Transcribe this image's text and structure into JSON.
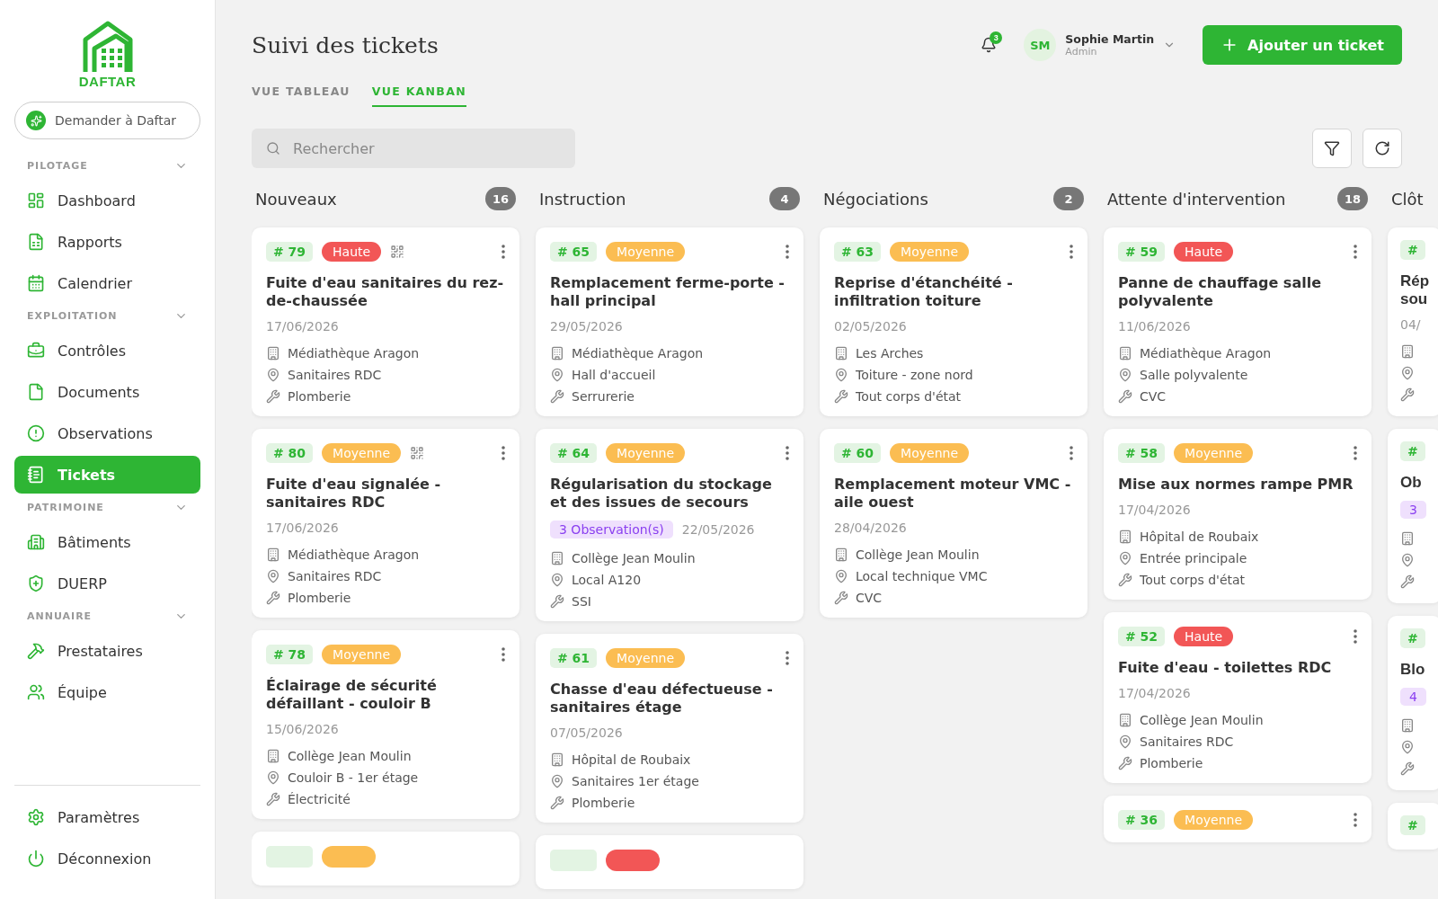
{
  "sidebar": {
    "logo": "DAFTAR",
    "ask_button": "Demander à Daftar",
    "sections": [
      {
        "title": "PILOTAGE",
        "expanded": true,
        "items": [
          {
            "label": "Dashboard",
            "selected": false
          },
          {
            "label": "Rapports",
            "selected": false
          },
          {
            "label": "Calendrier",
            "selected": false
          }
        ]
      },
      {
        "title": "EXPLOITATION",
        "expanded": true,
        "items": [
          {
            "label": "Contrôles",
            "selected": false
          },
          {
            "label": "Documents",
            "selected": false
          },
          {
            "label": "Observations",
            "selected": false
          },
          {
            "label": "Tickets",
            "selected": true
          }
        ]
      },
      {
        "title": "PATRIMOINE",
        "expanded": true,
        "items": [
          {
            "label": "Bâtiments",
            "selected": false
          },
          {
            "label": "DUERP",
            "selected": false
          }
        ]
      },
      {
        "title": "ANNUAIRE",
        "expanded": true,
        "items": [
          {
            "label": "Prestataires",
            "selected": false
          },
          {
            "label": "Équipe",
            "selected": false
          }
        ]
      }
    ],
    "footer": [
      "Paramètres",
      "Déconnexion"
    ]
  },
  "header": {
    "title": "Suivi des tickets",
    "notifications": "3",
    "user": {
      "initials": "SM",
      "name": "Sophie Martin",
      "role": "Admin"
    },
    "add_button": "Ajouter un ticket"
  },
  "tabs": [
    {
      "label": "VUE TABLEAU",
      "selected": false
    },
    {
      "label": "VUE KANBAN",
      "selected": true
    }
  ],
  "search": {
    "placeholder": "Rechercher"
  },
  "columns": [
    {
      "title": "Nouveaux",
      "count": "16",
      "cards": [
        {
          "kind": "ticket",
          "number": "# 79",
          "priority": {
            "label": "Haute",
            "kind": "high"
          },
          "qr": true,
          "title": "Fuite d'eau sanitaires du rez-de-chaussée",
          "date": "17/06/2026",
          "building": "Médiathèque Aragon",
          "place": "Sanitaires RDC",
          "trade": "Plomberie"
        },
        {
          "kind": "ticket",
          "number": "# 80",
          "priority": {
            "label": "Moyenne",
            "kind": "medium"
          },
          "qr": true,
          "title": "Fuite d'eau signalée - sanitaires RDC",
          "date": "17/06/2026",
          "building": "Médiathèque Aragon",
          "place": "Sanitaires RDC",
          "trade": "Plomberie"
        },
        {
          "kind": "ticket",
          "number": "# 78",
          "priority": {
            "label": "Moyenne",
            "kind": "medium"
          },
          "title": "Éclairage de sécurité défaillant - couloir B",
          "date": "15/06/2026",
          "building": "Collège Jean Moulin",
          "place": "Couloir B - 1er étage",
          "trade": "Électricité"
        },
        {
          "kind": "stub",
          "priority": {
            "kind": "medium"
          }
        }
      ]
    },
    {
      "title": "Instruction",
      "count": "4",
      "cards": [
        {
          "kind": "ticket",
          "number": "# 65",
          "priority": {
            "label": "Moyenne",
            "kind": "medium"
          },
          "title": "Remplacement ferme-porte - hall principal",
          "date": "29/05/2026",
          "building": "Médiathèque Aragon",
          "place": "Hall d'accueil",
          "trade": "Serrurerie"
        },
        {
          "kind": "ticket",
          "number": "# 64",
          "priority": {
            "label": "Moyenne",
            "kind": "medium"
          },
          "title": "Régularisation du stockage et des issues de secours",
          "observations": "3 Observation(s)",
          "date": "22/05/2026",
          "building": "Collège Jean Moulin",
          "place": "Local A120",
          "trade": "SSI"
        },
        {
          "kind": "ticket",
          "number": "# 61",
          "priority": {
            "label": "Moyenne",
            "kind": "medium"
          },
          "title": "Chasse d'eau défectueuse - sanitaires étage",
          "date": "07/05/2026",
          "building": "Hôpital de Roubaix",
          "place": "Sanitaires 1er étage",
          "trade": "Plomberie"
        },
        {
          "kind": "stub",
          "priority": {
            "kind": "high"
          }
        }
      ]
    },
    {
      "title": "Négociations",
      "count": "2",
      "cards": [
        {
          "kind": "ticket",
          "number": "# 63",
          "priority": {
            "label": "Moyenne",
            "kind": "medium"
          },
          "title": "Reprise d'étanchéité - infiltration toiture",
          "date": "02/05/2026",
          "building": "Les Arches",
          "place": "Toiture - zone nord",
          "trade": "Tout corps d'état"
        },
        {
          "kind": "ticket",
          "number": "# 60",
          "priority": {
            "label": "Moyenne",
            "kind": "medium"
          },
          "title": "Remplacement moteur VMC - aile ouest",
          "date": "28/04/2026",
          "building": "Collège Jean Moulin",
          "place": "Local technique VMC",
          "trade": "CVC"
        }
      ]
    },
    {
      "title": "Attente d'intervention",
      "count": "18",
      "cards": [
        {
          "kind": "ticket",
          "number": "# 59",
          "priority": {
            "label": "Haute",
            "kind": "high"
          },
          "title": "Panne de chauffage salle polyvalente",
          "date": "11/06/2026",
          "building": "Médiathèque Aragon",
          "place": "Salle polyvalente",
          "trade": "CVC"
        },
        {
          "kind": "ticket",
          "number": "# 58",
          "priority": {
            "label": "Moyenne",
            "kind": "medium"
          },
          "title": "Mise aux normes rampe PMR",
          "date": "17/04/2026",
          "building": "Hôpital de Roubaix",
          "place": "Entrée principale",
          "trade": "Tout corps d'état"
        },
        {
          "kind": "ticket",
          "number": "# 52",
          "priority": {
            "label": "Haute",
            "kind": "high"
          },
          "title": "Fuite d'eau - toilettes RDC",
          "date": "17/04/2026",
          "building": "Collège Jean Moulin",
          "place": "Sanitaires RDC",
          "trade": "Plomberie"
        },
        {
          "kind": "ticket",
          "number": "# 36",
          "priority": {
            "label": "Moyenne",
            "kind": "medium"
          }
        }
      ]
    },
    {
      "title": "Clôt",
      "partial": true,
      "cards": [
        {
          "kind": "ticket",
          "number": "#",
          "title": "Rép\nsou",
          "date": "04/",
          "meta_icons": true
        },
        {
          "kind": "ticket",
          "number": "#",
          "title": "Ob",
          "observations": "3",
          "meta_icons": true
        },
        {
          "kind": "ticket",
          "number": "#",
          "title": "Blo",
          "observations": "4",
          "meta_icons": true
        },
        {
          "kind": "ticket",
          "number": "#"
        }
      ]
    }
  ]
}
